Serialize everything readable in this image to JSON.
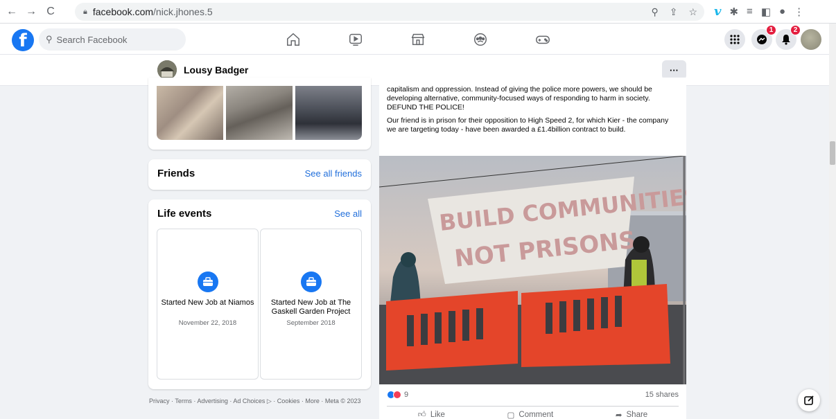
{
  "browser": {
    "url_host": "facebook.com",
    "url_path": "/nick.jhones.5"
  },
  "fb_header": {
    "search_placeholder": "Search Facebook",
    "messenger_badge": "1",
    "notifications_badge": "2"
  },
  "profile_bar": {
    "name": "Lousy Badger",
    "more_label": "···"
  },
  "friends": {
    "title": "Friends",
    "link": "See all friends"
  },
  "life_events": {
    "title": "Life events",
    "link": "See all",
    "items": [
      {
        "title": "Started New Job at Niamos",
        "date": "November 22, 2018"
      },
      {
        "title": "Started New Job at The Gaskell Garden Project",
        "date": "September 2018"
      }
    ]
  },
  "footer": {
    "text": "Privacy · Terms · Advertising · Ad Choices ▷ · Cookies · More · Meta © 2023"
  },
  "post": {
    "paragraph1": "capitalism and oppression. Instead of giving the police more powers, we should be developing alternative, community-focused ways of responding to harm in society. DEFUND THE POLICE!",
    "paragraph2": "Our friend is in prison for their opposition to High Speed 2, for which Kier - the company we are targeting today - have been awarded a £1.4billion contract to build.",
    "banner_line1": "BUILD COMMUNITIES",
    "banner_line2": "NOT PRISONS",
    "reaction_count": "9",
    "shares": "15 shares",
    "like_label": "Like",
    "comment_label": "Comment",
    "share_label": "Share"
  },
  "colors": {
    "fb_blue": "#1877f2",
    "link_blue": "#216fdb",
    "badge_red": "#e41e3f",
    "barrier_orange": "#e4452a"
  }
}
